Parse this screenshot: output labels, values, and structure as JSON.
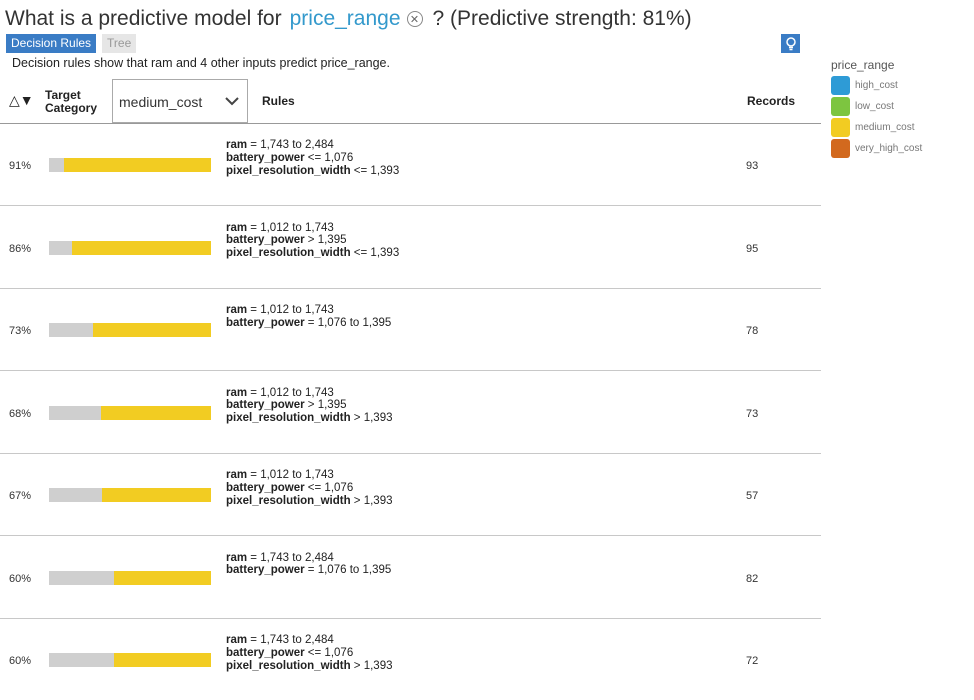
{
  "question": {
    "prefix": "What is a predictive model for",
    "target": "price_range",
    "suffix": "? (Predictive strength: 81%)"
  },
  "tabs": [
    {
      "label": "Decision Rules",
      "active": true
    },
    {
      "label": "Tree",
      "active": false
    }
  ],
  "description": "Decision rules show that ram and 4 other inputs predict price_range.",
  "header": {
    "sort_label": "△▼",
    "target_line1": "Target",
    "target_line2": "Category",
    "dropdown_value": "medium_cost",
    "rules": "Rules",
    "records": "Records"
  },
  "rows": [
    {
      "pct": "91%",
      "fill": 0.91,
      "records": "93",
      "rules": [
        {
          "field": "ram",
          "cond": " = 1,743 to 2,484"
        },
        {
          "field": "battery_power",
          "cond": " <= 1,076"
        },
        {
          "field": "pixel_resolution_width",
          "cond": " <= 1,393"
        }
      ]
    },
    {
      "pct": "86%",
      "fill": 0.86,
      "records": "95",
      "rules": [
        {
          "field": "ram",
          "cond": " = 1,012 to 1,743"
        },
        {
          "field": "battery_power",
          "cond": " > 1,395"
        },
        {
          "field": "pixel_resolution_width",
          "cond": " <= 1,393"
        }
      ]
    },
    {
      "pct": "73%",
      "fill": 0.73,
      "records": "78",
      "rules": [
        {
          "field": "ram",
          "cond": " = 1,012 to 1,743"
        },
        {
          "field": "battery_power",
          "cond": " = 1,076 to 1,395"
        }
      ]
    },
    {
      "pct": "68%",
      "fill": 0.68,
      "records": "73",
      "rules": [
        {
          "field": "ram",
          "cond": " = 1,012 to 1,743"
        },
        {
          "field": "battery_power",
          "cond": " > 1,395"
        },
        {
          "field": "pixel_resolution_width",
          "cond": " > 1,393"
        }
      ]
    },
    {
      "pct": "67%",
      "fill": 0.67,
      "records": "57",
      "rules": [
        {
          "field": "ram",
          "cond": " = 1,012 to 1,743"
        },
        {
          "field": "battery_power",
          "cond": " <= 1,076"
        },
        {
          "field": "pixel_resolution_width",
          "cond": " > 1,393"
        }
      ]
    },
    {
      "pct": "60%",
      "fill": 0.6,
      "records": "82",
      "rules": [
        {
          "field": "ram",
          "cond": " = 1,743 to 2,484"
        },
        {
          "field": "battery_power",
          "cond": " = 1,076 to 1,395"
        }
      ]
    },
    {
      "pct": "60%",
      "fill": 0.6,
      "records": "72",
      "rules": [
        {
          "field": "ram",
          "cond": " = 1,743 to 2,484"
        },
        {
          "field": "battery_power",
          "cond": " <= 1,076"
        },
        {
          "field": "pixel_resolution_width",
          "cond": " > 1,393"
        }
      ]
    }
  ],
  "legend": {
    "title": "price_range",
    "items": [
      {
        "label": "high_cost",
        "color": "#2e9bd6"
      },
      {
        "label": "low_cost",
        "color": "#7dc540"
      },
      {
        "label": "medium_cost",
        "color": "#f2cc22"
      },
      {
        "label": "very_high_cost",
        "color": "#d2691e"
      }
    ]
  }
}
